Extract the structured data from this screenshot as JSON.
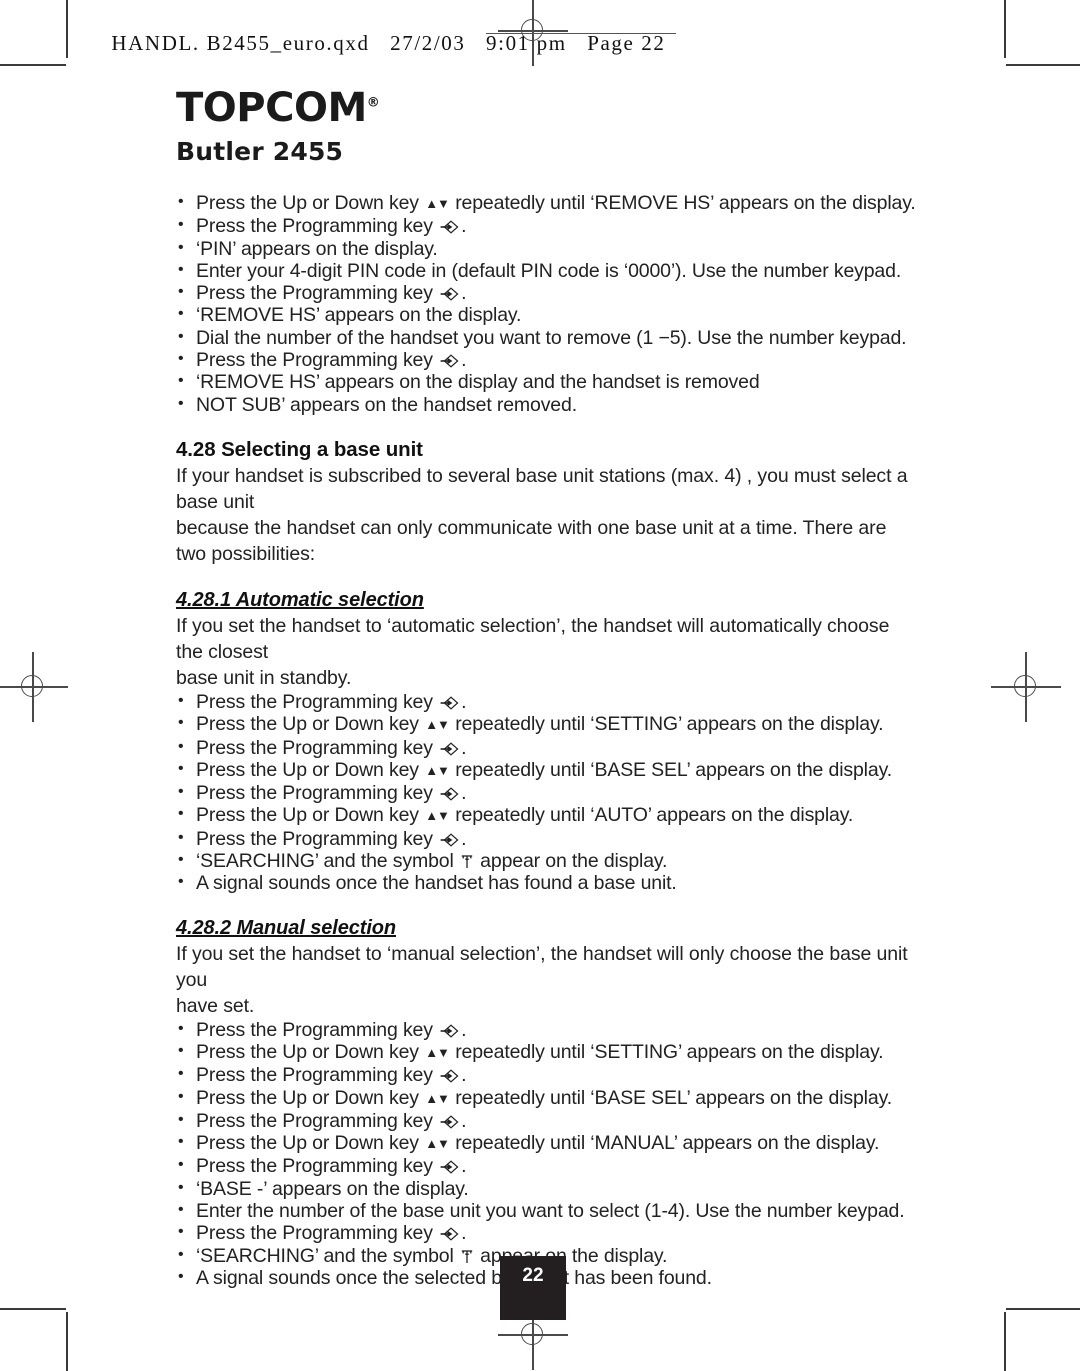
{
  "file_header": {
    "text": "HANDL. B2455_euro.qxd   27/2/03   9:01 pm   Page 22"
  },
  "logo": {
    "brand": "TOPCOM",
    "registered_symbol": "®",
    "model": "Butler 2455"
  },
  "page_number": "22",
  "sections": [
    {
      "id": "remove-hs-steps",
      "steps": [
        {
          "pre": "Press the Up or Down key ",
          "icon": "up-down-arrows",
          "post": " repeatedly until ‘REMOVE HS’ appears on the display."
        },
        {
          "pre": "Press the Programming key ",
          "icon": "programming-key",
          "post": "."
        },
        {
          "pre": "‘PIN’ appears on the display.",
          "icon": null,
          "post": ""
        },
        {
          "pre": "Enter your 4-digit PIN code in (default PIN code is ‘0000’). Use the number keypad.",
          "icon": null,
          "post": ""
        },
        {
          "pre": "Press the Programming key ",
          "icon": "programming-key",
          "post": "."
        },
        {
          "pre": "‘REMOVE HS’ appears on the display.",
          "icon": null,
          "post": ""
        },
        {
          "pre": "Dial the number of the handset you want to remove (1 −5). Use the number keypad.",
          "icon": null,
          "post": ""
        },
        {
          "pre": "Press the Programming key ",
          "icon": "programming-key",
          "post": "."
        },
        {
          "pre": "‘REMOVE HS’ appears on the display and the handset is removed",
          "icon": null,
          "post": ""
        },
        {
          "pre": "NOT SUB’ appears on the handset removed.",
          "icon": null,
          "post": ""
        }
      ]
    }
  ],
  "section_4_28": {
    "heading": "4.28 Selecting a base unit",
    "paragraph_line_1": "If your handset is subscribed to several base unit stations (max. 4) , you must select a base unit",
    "paragraph_line_2": "because the handset can only communicate with one base unit at a time. There are two possibilities:"
  },
  "section_4_28_1": {
    "heading": "4.28.1 Automatic selection",
    "paragraph_line_1": "If you set the handset to ‘automatic selection’, the handset will automatically choose the closest",
    "paragraph_line_2": "base unit in standby.",
    "steps": [
      {
        "pre": "Press the Programming key ",
        "icon": "programming-key",
        "post": "."
      },
      {
        "pre": "Press the Up or Down key ",
        "icon": "up-down-arrows",
        "post": " repeatedly until ‘SETTING’ appears on the display."
      },
      {
        "pre": "Press the Programming key ",
        "icon": "programming-key",
        "post": "."
      },
      {
        "pre": "Press the Up or Down key ",
        "icon": "up-down-arrows",
        "post": " repeatedly until ‘BASE SEL’ appears on the display."
      },
      {
        "pre": "Press the Programming key ",
        "icon": "programming-key",
        "post": "."
      },
      {
        "pre": "Press the Up or Down key ",
        "icon": "up-down-arrows",
        "post": " repeatedly until ‘AUTO’ appears on the display."
      },
      {
        "pre": "Press the Programming key ",
        "icon": "programming-key",
        "post": "."
      },
      {
        "pre": "‘SEARCHING’ and the symbol ",
        "icon": "antenna-symbol",
        "post": " appear on the display."
      },
      {
        "pre": "A signal sounds once the handset has found a base unit.",
        "icon": null,
        "post": ""
      }
    ]
  },
  "section_4_28_2": {
    "heading": "4.28.2 Manual selection",
    "paragraph_line_1": "If you set the handset to ‘manual selection’, the handset will only choose the base unit you",
    "paragraph_line_2": "have set.",
    "steps": [
      {
        "pre": "Press the Programming key ",
        "icon": "programming-key",
        "post": "."
      },
      {
        "pre": "Press the Up or Down key ",
        "icon": "up-down-arrows",
        "post": " repeatedly until ‘SETTING’ appears on the display."
      },
      {
        "pre": "Press the Programming key ",
        "icon": "programming-key",
        "post": "."
      },
      {
        "pre": "Press the Up or Down key ",
        "icon": "up-down-arrows",
        "post": " repeatedly until ‘BASE SEL’ appears on the display."
      },
      {
        "pre": "Press the Programming key ",
        "icon": "programming-key",
        "post": "."
      },
      {
        "pre": "Press the Up or Down key ",
        "icon": "up-down-arrows",
        "post": " repeatedly until ‘MANUAL’ appears on the display."
      },
      {
        "pre": "Press the Programming key ",
        "icon": "programming-key",
        "post": "."
      },
      {
        "pre": "‘BASE -’ appears on the display.",
        "icon": null,
        "post": ""
      },
      {
        "pre": "Enter the number of the base unit you want to select (1-4). Use the number keypad.",
        "icon": null,
        "post": ""
      },
      {
        "pre": "Press the Programming key ",
        "icon": "programming-key",
        "post": "."
      },
      {
        "pre": "‘SEARCHING’ and the symbol ",
        "icon": "antenna-symbol",
        "post": " appear on the display."
      },
      {
        "pre": "A signal sounds once the selected base unit has been found.",
        "icon": null,
        "post": ""
      }
    ]
  },
  "colors": {
    "text": "#222222",
    "page_badge_bg": "#231f20",
    "page_badge_text": "#ffffff",
    "crop_mark": "#3a3a3a"
  }
}
